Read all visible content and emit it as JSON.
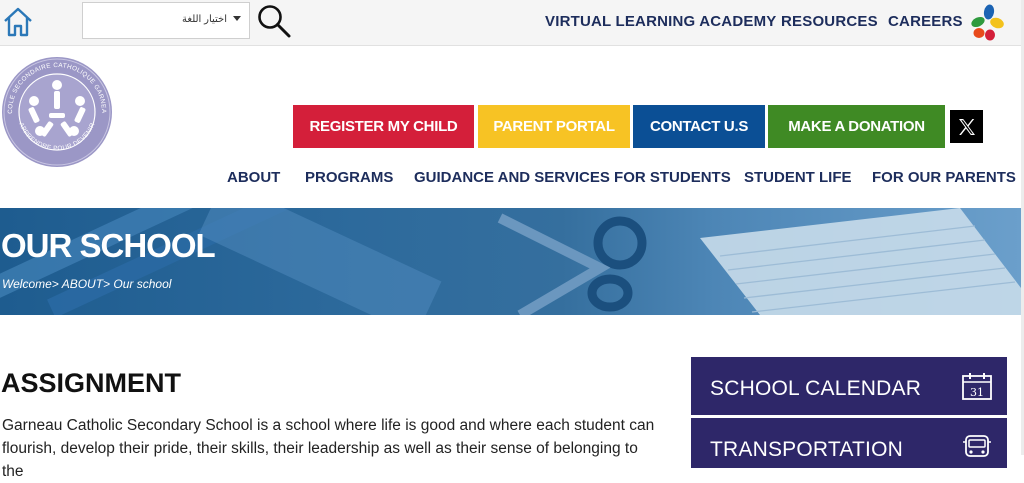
{
  "topbar": {
    "language_label": "اختيار اللغة",
    "links": [
      "VIRTUAL LEARNING ACADEMY",
      "RESOURCES",
      "CAREERS"
    ],
    "icons": [
      "home-icon",
      "search-icon",
      "brand-logo"
    ]
  },
  "header": {
    "logo_text": [
      "ÉCOLE SECONDAIRE CATHOLIQUE GARNEAU",
      "APPRENDRE POUR DEVENIR"
    ],
    "cta": {
      "register": "REGISTER MY CHILD",
      "portal": "PARENT PORTAL",
      "contact": "CONTACT U.S",
      "donate": "MAKE A DONATION"
    },
    "social_icon": "x-icon",
    "nav": [
      "ABOUT",
      "PROGRAMS",
      "GUIDANCE AND SERVICES FOR STUDENTS",
      "STUDENT LIFE",
      "FOR OUR PARENTS"
    ]
  },
  "banner": {
    "title": "OUR SCHOOL",
    "breadcrumb": [
      "Welcome",
      "ABOUT",
      "Our school"
    ]
  },
  "content": {
    "heading": "ASSIGNMENT",
    "paragraph": "Garneau Catholic Secondary School is a school where life is good and where each student can flourish, develop their pride, their skills, their leadership as well as their sense of belonging to the"
  },
  "sidebar": {
    "cards": [
      {
        "label": "SCHOOL CALENDAR",
        "icon": "calendar-icon",
        "day": "31"
      },
      {
        "label": "TRANSPORTATION",
        "icon": "bus-icon"
      }
    ]
  },
  "colors": {
    "navy_text": "#1d2d5c",
    "register": "#d41f3a",
    "portal": "#f7c324",
    "contact": "#0b4f95",
    "donate": "#3f8a24",
    "sidebar": "#2e2769"
  }
}
